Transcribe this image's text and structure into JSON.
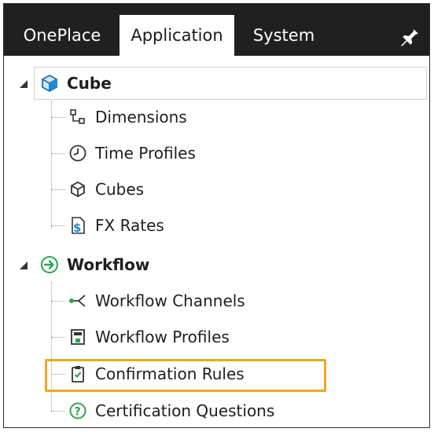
{
  "tabs": [
    {
      "label": "OnePlace",
      "active": false
    },
    {
      "label": "Application",
      "active": true
    },
    {
      "label": "System",
      "active": false
    }
  ],
  "tree": {
    "cube": {
      "label": "Cube",
      "children": [
        "Dimensions",
        "Time Profiles",
        "Cubes",
        "FX Rates"
      ]
    },
    "workflow": {
      "label": "Workflow",
      "children": [
        "Workflow Channels",
        "Workflow Profiles",
        "Confirmation Rules",
        "Certification Questions"
      ]
    }
  },
  "colors": {
    "tabbar": "#202020",
    "highlight": "#f0a61f",
    "cube_icon": "#1f8ad6",
    "workflow_icon": "#2fa44f"
  }
}
